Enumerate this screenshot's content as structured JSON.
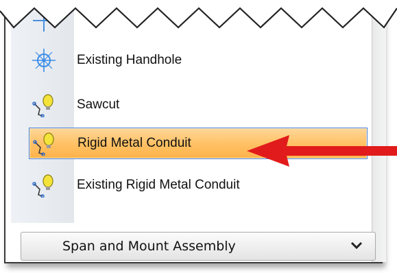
{
  "list": {
    "items": [
      {
        "label": "Existing Handhole",
        "icon": "handhole-icon"
      },
      {
        "label": "Sawcut",
        "icon": "conduit-bulb-icon"
      },
      {
        "label": "Rigid Metal Conduit",
        "icon": "conduit-bulb-icon",
        "selected": true
      },
      {
        "label": "Existing Rigid Metal Conduit",
        "icon": "conduit-bulb-icon"
      }
    ]
  },
  "footer": {
    "group_label": "Span and Mount Assembly",
    "icon": "chevron-down-icon"
  },
  "annotation": {
    "icon": "red-arrow-icon",
    "color": "#e11b1b"
  },
  "colors": {
    "selected_fill": "#ffc266",
    "selected_border": "#4a80d6"
  }
}
